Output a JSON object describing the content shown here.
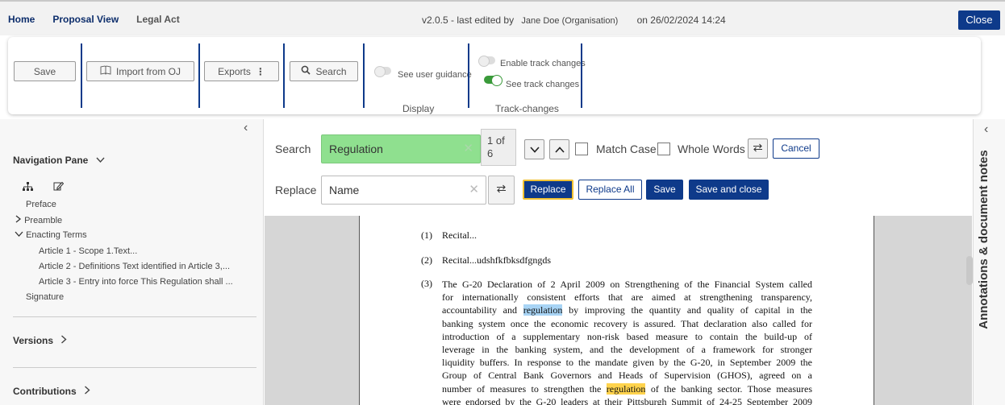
{
  "topbar": {
    "nav": [
      "Home",
      "Proposal View",
      "Legal Act"
    ],
    "version": "v2.0.5 - last edited by",
    "user": "Jane Doe (Organisation)",
    "edited_on": "on 26/02/2024 14:24",
    "close_label": "Close"
  },
  "toolbar": {
    "save": "Save",
    "import": "Import from OJ",
    "exports": "Exports",
    "search": "Search",
    "see_user_guidance": "See user guidance",
    "display_group": "Display",
    "enable_track_changes": "Enable track changes",
    "see_track_changes": "See track changes",
    "track_changes_group": "Track-changes",
    "toggles": {
      "see_user_guidance": false,
      "enable_track_changes": false,
      "see_track_changes": true
    }
  },
  "navigation": {
    "title": "Navigation Pane",
    "items": {
      "preface": "Preface",
      "preamble": "Preamble",
      "enacting_terms": "Enacting Terms",
      "article1": "Article 1 - Scope 1.Text...",
      "article2": "Article 2 - Definitions Text identified in Article 3,...",
      "article3": "Article 3 - Entry into force This Regulation shall ...",
      "signature": "Signature"
    },
    "versions": "Versions",
    "contributions": "Contributions"
  },
  "search_panel": {
    "search_label": "Search",
    "search_value": "Regulation",
    "counter_line1": "1 of",
    "counter_line2": "6",
    "match_case": "Match Case",
    "whole_words": "Whole Words",
    "cancel": "Cancel",
    "replace_label": "Replace",
    "replace_value": "Name",
    "replace_btn": "Replace",
    "replace_all_btn": "Replace All",
    "save_btn": "Save",
    "save_close_btn": "Save and close"
  },
  "document": {
    "recital1_num": "(1)",
    "recital1_text": "Recital...",
    "recital2_num": "(2)",
    "recital2_text": "Recital...udshfkfbksdfgngds",
    "recital3_num": "(3)",
    "recital3_lines": {
      "l1": "The G-20 Declaration of 2 April 2009 on Strengthening of the Financial System called",
      "l2": "for internationally consistent efforts that are aimed at strengthening transparency,",
      "l3a": "accountability and",
      "l3hl": "regulation",
      "l3b": "by improving the quantity and quality of capital in the",
      "l4": "banking system once the economic recovery is assured. That declaration also called for",
      "l5": "introduction of a supplementary non-risk based measure to contain the build-up of",
      "l6": "leverage in the banking system, and the development of a framework for stronger",
      "l7": "liquidity buffers. In response to the mandate given by the G-20, in September 2009 the",
      "l8": "Group of Central Bank Governors and Heads of Supervision (GHOS), agreed on a",
      "l9a": "number of measures to strengthen the",
      "l9hl": "regulation",
      "l9b": "of the banking sector. Those measures",
      "l10": "were endorsed by the G-20 leaders at their Pittsburgh Summit of 24-25 September 2009"
    }
  },
  "annotations": {
    "title": "Annotations & document notes"
  },
  "colors": {
    "brand": "#0e3a8a",
    "search_match": "#8fe08f",
    "current_highlight": "#a8d4f5",
    "other_highlight": "#ffd34d"
  }
}
